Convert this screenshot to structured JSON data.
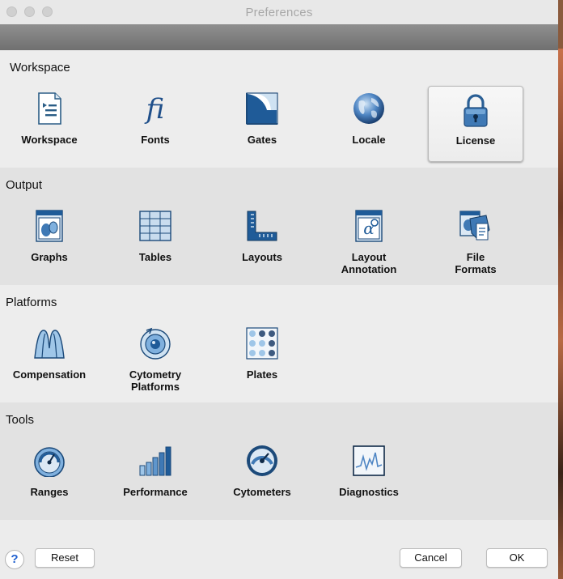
{
  "window": {
    "title": "Preferences"
  },
  "sections": [
    {
      "title": "Workspace",
      "items": [
        {
          "label": "Workspace",
          "icon": "workspace-document-icon"
        },
        {
          "label": "Fonts",
          "icon": "fonts-icon"
        },
        {
          "label": "Gates",
          "icon": "gates-icon"
        },
        {
          "label": "Locale",
          "icon": "globe-icon"
        },
        {
          "label": "License",
          "icon": "padlock-icon",
          "selected": true
        }
      ]
    },
    {
      "title": "Output",
      "items": [
        {
          "label": "Graphs",
          "icon": "graphs-icon"
        },
        {
          "label": "Tables",
          "icon": "tables-icon"
        },
        {
          "label": "Layouts",
          "icon": "layouts-ruler-icon"
        },
        {
          "label": "Layout\nAnnotation",
          "icon": "layout-annotation-icon"
        },
        {
          "label": "File\nFormats",
          "icon": "file-formats-icon"
        }
      ]
    },
    {
      "title": "Platforms",
      "items": [
        {
          "label": "Compensation",
          "icon": "compensation-icon"
        },
        {
          "label": "Cytometry\nPlatforms",
          "icon": "cytometry-platforms-icon"
        },
        {
          "label": "Plates",
          "icon": "plates-icon"
        }
      ]
    },
    {
      "title": "Tools",
      "items": [
        {
          "label": "Ranges",
          "icon": "ranges-gauge-icon"
        },
        {
          "label": "Performance",
          "icon": "performance-bars-icon"
        },
        {
          "label": "Cytometers",
          "icon": "cytometers-dial-icon"
        },
        {
          "label": "Diagnostics",
          "icon": "diagnostics-monitor-icon"
        }
      ]
    }
  ],
  "footer": {
    "help_label": "?",
    "reset_label": "Reset",
    "cancel_label": "Cancel",
    "ok_label": "OK"
  },
  "colors": {
    "accent": "#2a6fb0",
    "selected_border": "#b9b9b9"
  }
}
